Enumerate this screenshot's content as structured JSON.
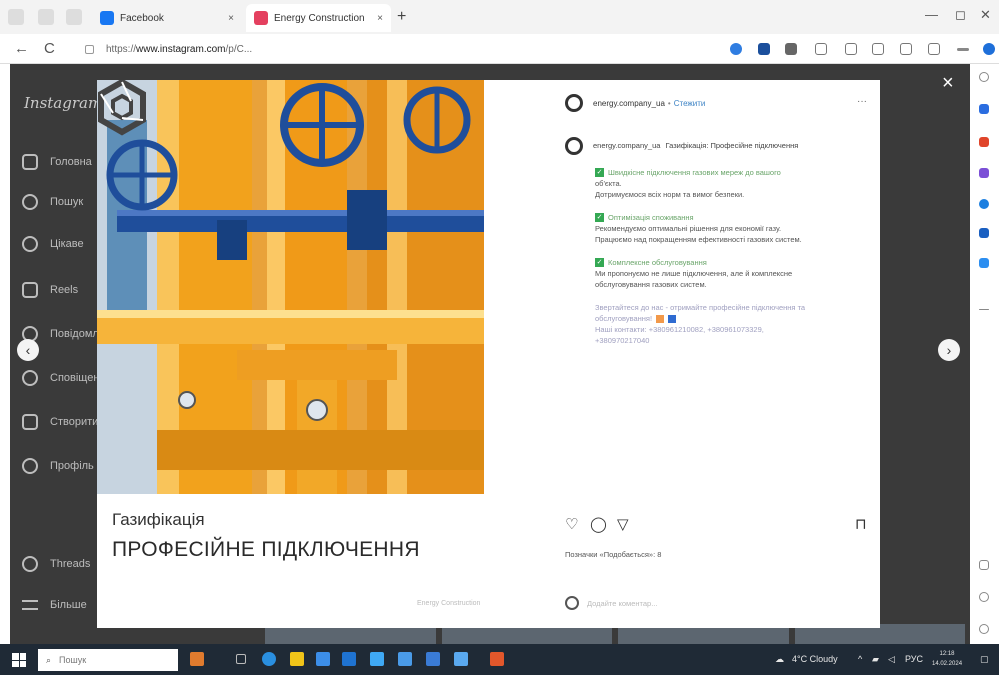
{
  "browser": {
    "tabs": [
      {
        "label": "Facebook",
        "favicon_color": "#1877f2",
        "active": false
      },
      {
        "label": "Energy Construction Company",
        "favicon_color": "#e4405f",
        "active": true
      }
    ],
    "tab_close": "×",
    "new_tab": "+",
    "window_controls": [
      "—",
      "◻",
      "✕"
    ],
    "nav": {
      "back": "←",
      "reload": "C"
    },
    "url": {
      "prefix": "https://",
      "domain": "www.instagram.com",
      "path": "/p/C..."
    }
  },
  "instagram": {
    "logo": "Instagram",
    "nav": [
      {
        "icon": "home-icon",
        "label": "Головна"
      },
      {
        "icon": "search-icon",
        "label": "Пошук"
      },
      {
        "icon": "explore-icon",
        "label": "Цікаве"
      },
      {
        "icon": "reels-icon",
        "label": "Reels"
      },
      {
        "icon": "messages-icon",
        "label": "Повідомлення"
      },
      {
        "icon": "heart-icon",
        "label": "Сповіщення"
      },
      {
        "icon": "create-icon",
        "label": "Створити"
      },
      {
        "icon": "profile-icon",
        "label": "Профіль"
      },
      {
        "icon": "threads-icon",
        "label": "Threads"
      },
      {
        "icon": "more-icon",
        "label": "Більше"
      }
    ]
  },
  "modal": {
    "close": "×",
    "prev": "‹",
    "next": "›",
    "media": {
      "title": "Газифікація",
      "subtitle": "ПРОФЕСІЙНЕ ПІДКЛЮЧЕННЯ",
      "brand_caption": "Energy Construction"
    },
    "header": {
      "username": "energy.company_ua",
      "separator": "•",
      "follow": "Стежити",
      "more": "···"
    },
    "caption": {
      "author": "energy.company_ua",
      "text": "Газифікація: Професійне підключення",
      "features": [
        {
          "heading": "Швидкісне підключення газових мереж до вашого",
          "lines": [
            "об'єкта.",
            "Дотримуємося всіх норм та вимог безпеки."
          ]
        },
        {
          "heading": "Оптимізація споживання",
          "lines": [
            "Рекомендуємо оптимальні рішення для економії газу.",
            "Працюємо над покращенням ефективності газових систем."
          ]
        },
        {
          "heading": "Комплексне обслуговування",
          "lines": [
            "Ми пропонуємо не лише підключення, але й комплексне",
            "обслуговування газових систем."
          ]
        }
      ],
      "cta": "Звертайтеся до нас - отримайте професійне підключення та",
      "cta2": "обслуговування!",
      "contacts": "Наші контакти: +380961210082, +380961073329,",
      "contacts2": "+380970217040"
    },
    "actions": {
      "like_icon": "heart-icon",
      "comment_icon": "comment-icon",
      "share_icon": "share-icon",
      "save_icon": "bookmark-icon"
    },
    "likes_text": "Позначки «Подобається»: 8",
    "comment_placeholder": "Додайте коментар..."
  },
  "taskbar": {
    "search_placeholder": "Пошук",
    "weather": "4°C Cloudy",
    "language": "РУС",
    "time": "12:18",
    "date": "14.02.2024"
  },
  "colors": {
    "pipe_orange": "#f5a623",
    "valve_blue": "#1f4e9b",
    "check_green": "#34a853",
    "link_blue": "#3b82c4"
  }
}
